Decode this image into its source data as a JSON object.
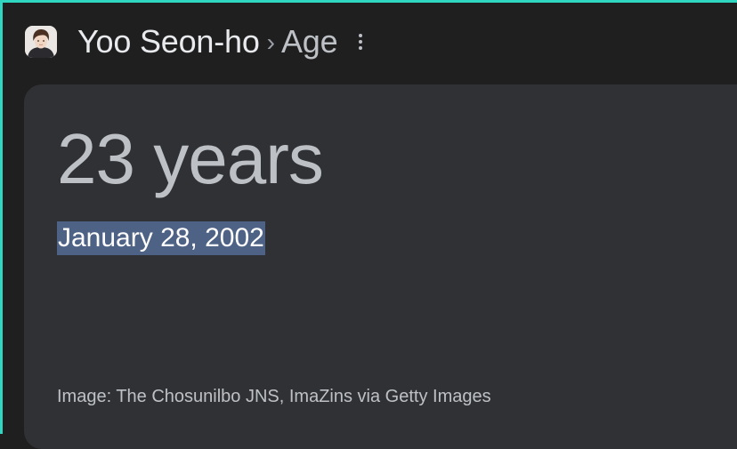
{
  "header": {
    "entity_name": "Yoo Seon-ho",
    "separator": "›",
    "attribute": "Age",
    "avatar_icon": "person-photo-icon",
    "more_icon": "more-vert-icon"
  },
  "card": {
    "answer": "23 years",
    "birth_date": "January 28, 2002",
    "image_credit": "Image: The Chosunilbo JNS, ImaZins via Getty Images"
  },
  "colors": {
    "page_bg": "#1f1f1f",
    "card_bg": "#303134",
    "selection_bg": "#4d6285",
    "accent_edge": "#2fd6c0",
    "primary_text": "#e8eaed",
    "secondary_text": "#bdc1c6"
  }
}
